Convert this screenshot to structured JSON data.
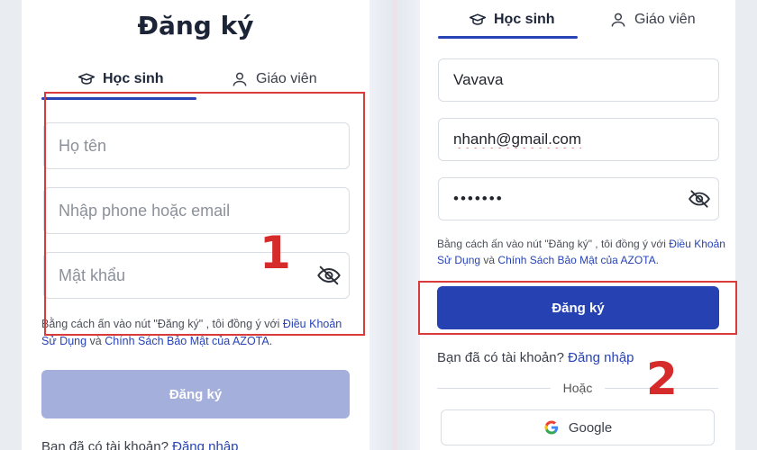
{
  "left": {
    "title": "Đăng ký",
    "tabs": {
      "student": "Học sinh",
      "teacher": "Giáo viên"
    },
    "fields": {
      "name_placeholder": "Họ tên",
      "contact_placeholder": "Nhập phone hoặc email",
      "password_placeholder": "Mật khẩu"
    },
    "terms": {
      "prefix": "Bằng cách ấn vào nút \"Đăng ký\" , tôi đồng ý với ",
      "link1": "Điều Khoản Sử Dụng",
      "middle": " và ",
      "link2": "Chính Sách Bảo Mật của AZOTA",
      "suffix": "."
    },
    "submit_label": "Đăng ký",
    "login": {
      "prompt": "Bạn đã có tài khoản? ",
      "link": "Đăng nhập"
    },
    "step_label": "1"
  },
  "right": {
    "tabs": {
      "student": "Học sinh",
      "teacher": "Giáo viên"
    },
    "fields": {
      "name_value": "Vavava",
      "email_value": "nhanh@gmail.com",
      "password_value": "1234567"
    },
    "terms": {
      "prefix": "Bằng cách ấn vào nút \"Đăng ký\" , tôi đồng ý với ",
      "link1": "Điều Khoản Sử Dụng",
      "middle": " và ",
      "link2": "Chính Sách Bảo Mật của AZOTA",
      "suffix": "."
    },
    "submit_label": "Đăng ký",
    "login": {
      "prompt": "Bạn đã có tài khoản? ",
      "link": "Đăng nhập"
    },
    "or_label": "Hoặc",
    "google_label": "Google",
    "step_label": "2"
  },
  "colors": {
    "brand": "#2641b2",
    "disabled": "#a5afdc",
    "highlight": "#d93a3a"
  }
}
